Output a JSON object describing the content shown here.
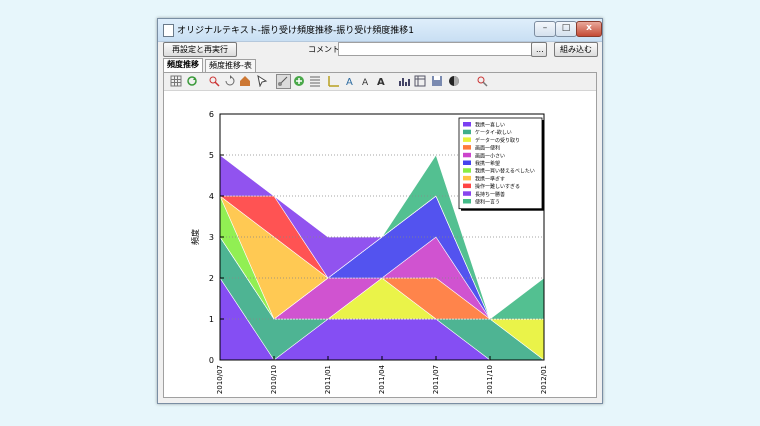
{
  "window": {
    "title": "オリジナルテキスト-振り受け頻度推移-振り受け頻度推移1",
    "controls": {
      "minimize": "–",
      "maximize": "□",
      "close": "x"
    }
  },
  "toolbar": {
    "reconfigure_label": "再設定と再実行",
    "comment_label": "コメント:",
    "comment_value": "",
    "ellipsis_label": "...",
    "load_label": "組み込む"
  },
  "tabs": [
    {
      "label": "頻度推移",
      "active": true
    },
    {
      "label": "頻度推移-表",
      "active": false
    }
  ],
  "chart_toolbar": {
    "icons": [
      "grid-icon",
      "refresh-icon",
      "zoom-icon",
      "rotate-icon",
      "home-icon",
      "pointer-icon",
      "select-icon",
      "plus-icon",
      "list-icon",
      "axis-icon",
      "font-icon",
      "text-icon",
      "bold-text-icon",
      "bar-chart-icon",
      "table-icon",
      "save-icon",
      "color-icon",
      "settings-icon"
    ]
  },
  "chart_data": {
    "type": "area",
    "title": "",
    "xlabel": "",
    "ylabel": "頻度",
    "ylim": [
      0,
      6
    ],
    "yticks": [
      "0",
      "1",
      "2",
      "3",
      "4",
      "5",
      "6"
    ],
    "categories": [
      "2010/07",
      "2010/10",
      "2011/01",
      "2011/04",
      "2011/07",
      "2011/10",
      "2012/01"
    ],
    "grid": true,
    "legend_position": "top-right",
    "stacked": true,
    "series": [
      {
        "name": "我携一喜しい",
        "color": "#7b3ff2",
        "values": [
          2,
          0,
          1,
          1,
          1,
          0,
          0
        ]
      },
      {
        "name": "ケータイ-欲しい",
        "color": "#3fae8a",
        "values": [
          1,
          1,
          0,
          0,
          0,
          1,
          0
        ]
      },
      {
        "name": "データーの受り取り",
        "color": "#e8f23a",
        "values": [
          0,
          0,
          0,
          1,
          0,
          0,
          1
        ]
      },
      {
        "name": "画面一便利",
        "color": "#ff7a3c",
        "values": [
          0,
          0,
          0,
          0,
          1,
          0,
          0
        ]
      },
      {
        "name": "画面一小さい",
        "color": "#cc44cc",
        "values": [
          0,
          0,
          1,
          0,
          1,
          0,
          0
        ]
      },
      {
        "name": "我携一希望",
        "color": "#4444ee",
        "values": [
          0,
          0,
          0,
          1,
          1,
          0,
          0
        ]
      },
      {
        "name": "我携一買い替えるべしたい",
        "color": "#88ee44",
        "values": [
          1,
          0,
          0,
          0,
          0,
          0,
          0
        ]
      },
      {
        "name": "我携一準ぎす",
        "color": "#ffc444",
        "values": [
          0,
          2,
          0,
          0,
          0,
          0,
          0
        ]
      },
      {
        "name": "操作一難しいすぎる",
        "color": "#ff4444",
        "values": [
          0,
          1,
          0,
          0,
          0,
          0,
          0
        ]
      },
      {
        "name": "長持ち一勝善",
        "color": "#8844ee",
        "values": [
          1,
          0,
          1,
          0,
          0,
          0,
          0
        ]
      },
      {
        "name": "便利一言う",
        "color": "#44bb88",
        "values": [
          0,
          0,
          0,
          0,
          1,
          0,
          1
        ]
      }
    ]
  }
}
